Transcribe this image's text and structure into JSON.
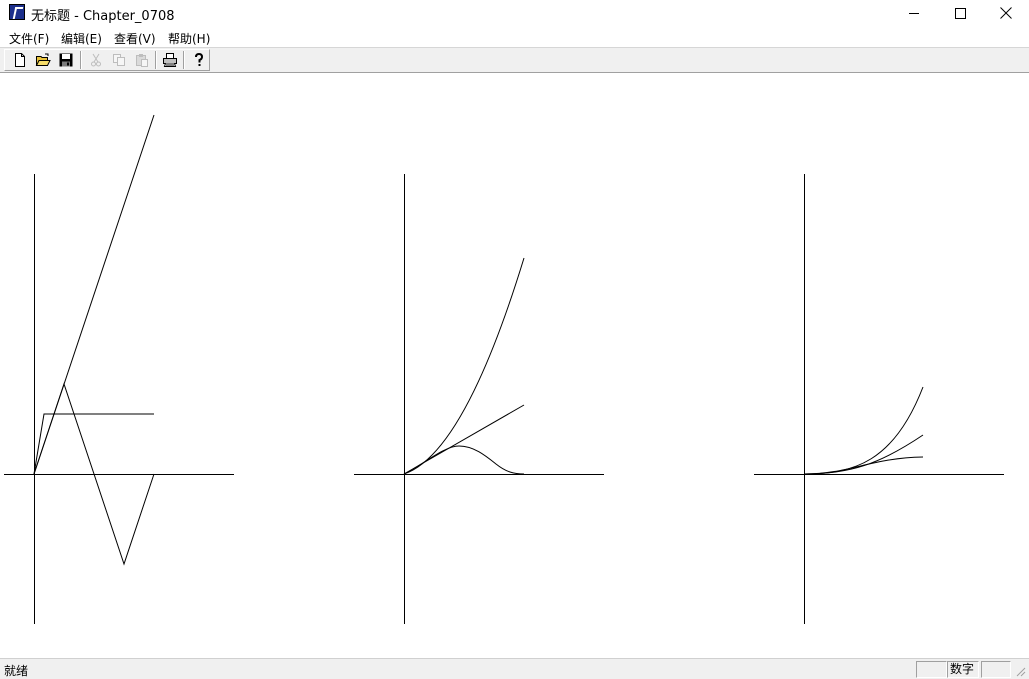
{
  "window": {
    "title": "无标题 - Chapter_0708",
    "controls": {
      "minimize": "minimize",
      "maximize": "maximize",
      "close": "close"
    }
  },
  "menu": {
    "items": [
      {
        "label": "文件(F)"
      },
      {
        "label": "编辑(E)"
      },
      {
        "label": "查看(V)"
      },
      {
        "label": "帮助(H)"
      }
    ]
  },
  "toolbar": {
    "buttons": [
      {
        "icon": "new-document-icon",
        "enabled": true
      },
      {
        "icon": "open-folder-icon",
        "enabled": true
      },
      {
        "icon": "save-icon",
        "enabled": true
      },
      {
        "icon": "cut-icon",
        "enabled": false
      },
      {
        "icon": "copy-icon",
        "enabled": false
      },
      {
        "icon": "paste-icon",
        "enabled": false
      },
      {
        "icon": "print-icon",
        "enabled": true
      },
      {
        "icon": "help-icon",
        "enabled": true
      }
    ]
  },
  "status": {
    "ready_text": "就绪",
    "num_indicator": "数字",
    "empty_indicator": ""
  },
  "colors": {
    "line": "#000000",
    "background": "#ffffff",
    "chrome": "#f0f0f0"
  }
}
